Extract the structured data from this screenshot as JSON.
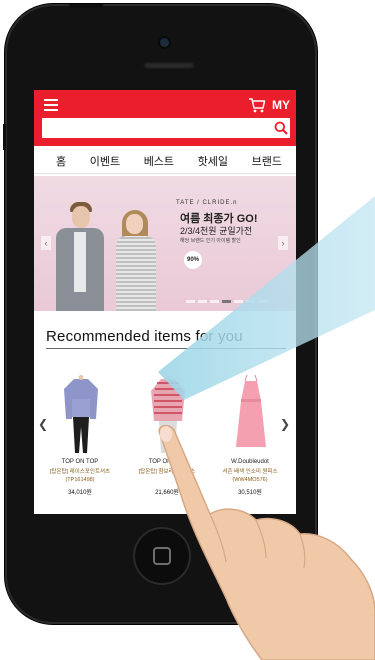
{
  "app_bar": {
    "my_label": "MY",
    "accent_color": "#ea1f2b"
  },
  "search": {
    "value": "",
    "placeholder": ""
  },
  "tabs": [
    {
      "label": "홈"
    },
    {
      "label": "이벤트"
    },
    {
      "label": "베스트"
    },
    {
      "label": "핫세일"
    },
    {
      "label": "브랜드"
    }
  ],
  "banner": {
    "brand": "TATE / CLRIDE.n",
    "title": "여름 최종가 GO!",
    "subtitle": "2/3/4천원 균일가전",
    "note": "해당 브랜드 인기 아이템 할인",
    "badge": "90%"
  },
  "section": {
    "title": "Recommended items for you"
  },
  "products": [
    {
      "brand": "TOP ON TOP",
      "name": "[탑온탑] 레이스포인트셔츠 (TP161498)",
      "price": "34,010원"
    },
    {
      "brand": "TOP ON TOP",
      "name": "[탑온탑] 첨보라 블라우스",
      "price": "21,660원"
    },
    {
      "brand": "W.Doubleudot",
      "name": "셔츤 배색 인소미 원피스 (WW4MO576)",
      "price": "30,510원"
    }
  ]
}
